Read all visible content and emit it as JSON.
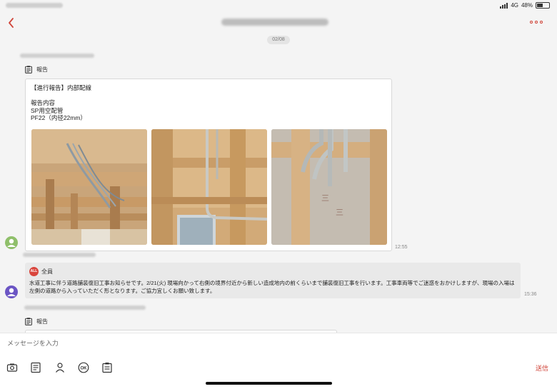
{
  "status_bar": {
    "network": "4G",
    "battery": "48%",
    "battery_level": 0.48
  },
  "chat": {
    "date_separator": "02/08",
    "report_message": {
      "type_label": "報告",
      "text_lines": [
        "【進行報告】内部配線",
        "",
        "報告内容",
        "SP用空配管",
        "PF22（内径22mm）"
      ],
      "time": "12:55"
    },
    "notice_message": {
      "audience_badge": "ALL",
      "audience_label": "全員",
      "text": "水道工事に伴う道路舗装復旧工事お知らせです。2/21(火) 現場向かって右側の境界付近から新しい造成地内の前くらいまで舗装復旧工事を行います。工事車両等でご迷惑をおかけしますが、現場の入場は左側の道路から入っていただく形となります。ご協力宜しくお願い致します。",
      "time": "15:36"
    },
    "partial_message": {
      "type_label": "報告"
    }
  },
  "composer": {
    "placeholder": "メッセージを入力",
    "tool_icons": [
      "camera-icon",
      "list-icon",
      "person-icon",
      "ok-stamp-icon",
      "report-icon"
    ],
    "ok_label": "OK",
    "send_label": "送信"
  },
  "colors": {
    "accent": "#d0453a",
    "bubble_gray": "#e9e9e9",
    "background": "#f4f4f4"
  }
}
